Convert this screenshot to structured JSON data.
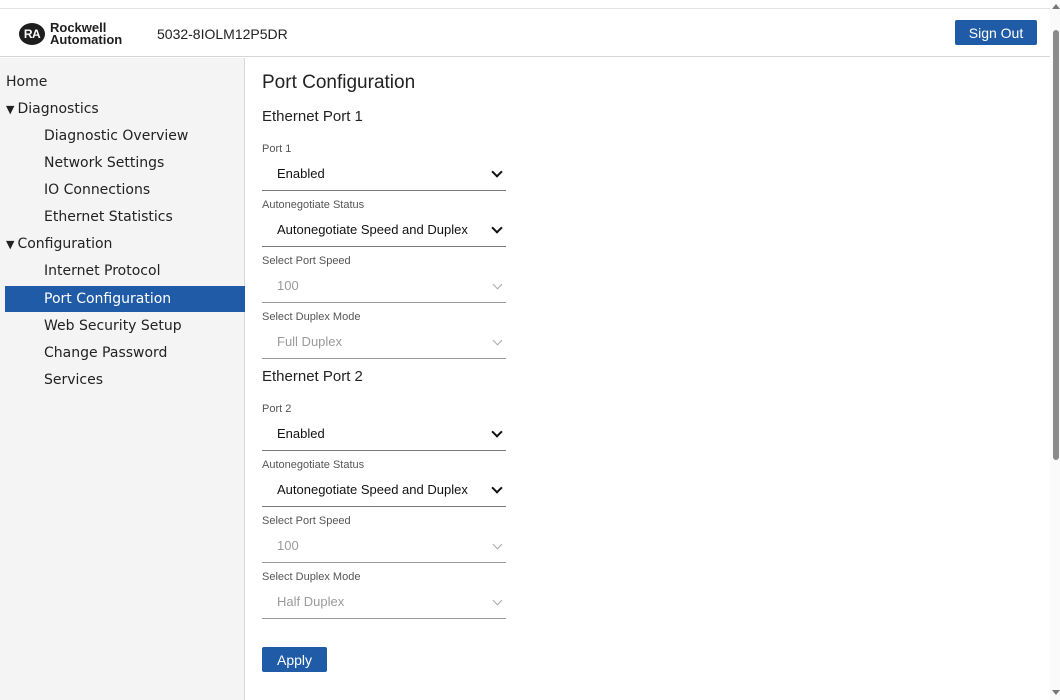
{
  "header": {
    "logo_mark": "RA",
    "logo_line1": "Rockwell",
    "logo_line2": "Automation",
    "device_name": "5032-8IOLM12P5DR",
    "sign_out_label": "Sign Out"
  },
  "sidebar": {
    "items": [
      {
        "label": "Home"
      },
      {
        "label": "Diagnostics",
        "expanded": true
      },
      {
        "label": "Diagnostic Overview"
      },
      {
        "label": "Network Settings"
      },
      {
        "label": "IO Connections"
      },
      {
        "label": "Ethernet Statistics"
      },
      {
        "label": "Configuration",
        "expanded": true
      },
      {
        "label": "Internet Protocol"
      },
      {
        "label": "Port Configuration",
        "active": true
      },
      {
        "label": "Web Security Setup"
      },
      {
        "label": "Change Password"
      },
      {
        "label": "Services"
      }
    ],
    "expand_glyph": "▼"
  },
  "main": {
    "title": "Port Configuration",
    "port1": {
      "heading": "Ethernet Port 1",
      "enable_label": "Port 1",
      "enable_value": "Enabled",
      "autoneg_label": "Autonegotiate Status",
      "autoneg_value": "Autonegotiate Speed and Duplex",
      "speed_label": "Select Port Speed",
      "speed_value": "100",
      "duplex_label": "Select Duplex Mode",
      "duplex_value": "Full Duplex"
    },
    "port2": {
      "heading": "Ethernet Port 2",
      "enable_label": "Port 2",
      "enable_value": "Enabled",
      "autoneg_label": "Autonegotiate Status",
      "autoneg_value": "Autonegotiate Speed and Duplex",
      "speed_label": "Select Port Speed",
      "speed_value": "100",
      "duplex_label": "Select Duplex Mode",
      "duplex_value": "Half Duplex"
    },
    "apply_label": "Apply"
  },
  "colors": {
    "accent": "#1f5ba6",
    "sidebar_bg": "#f4f4f4",
    "disabled_text": "#9a9a9a"
  }
}
